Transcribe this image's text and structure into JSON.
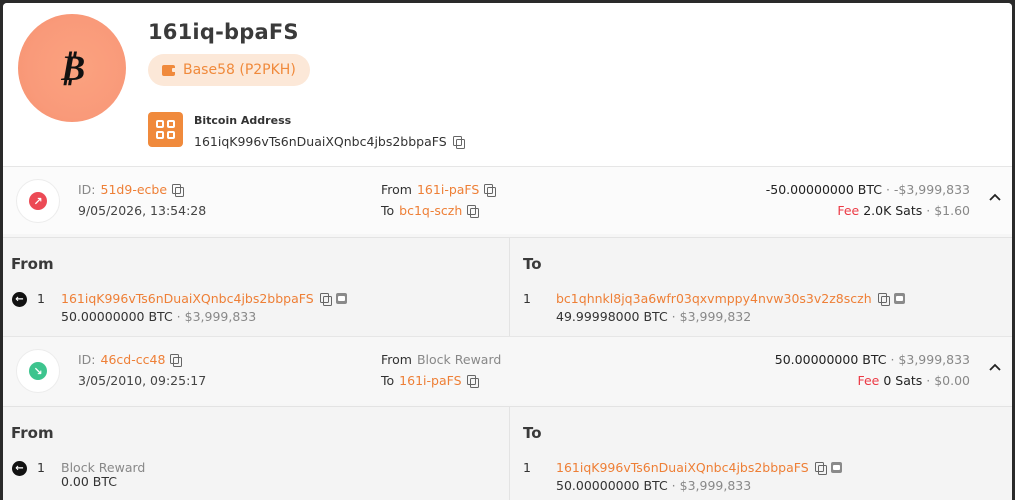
{
  "header": {
    "avatar_symbol": "₿",
    "title": "161iq-bpaFS",
    "badge_label": "Base58 (P2PKH)",
    "address_label": "Bitcoin Address",
    "address_value": "161iqK996vTs6nDuaiXQnbc4jbs2bbpaFS"
  },
  "transactions": [
    {
      "direction": "out",
      "id_prefix": "ID:",
      "id": "51d9-ecbe",
      "date": "9/05/2026, 13:54:28",
      "from_label": "From",
      "from": "161i-paFS",
      "to_label": "To",
      "to": "bc1q-sczh",
      "amount": "-50.00000000 BTC",
      "amount_usd": "· -$3,999,833",
      "fee_label": "Fee",
      "fee_sats": "2.0K Sats",
      "fee_usd": "· $1.60",
      "details": {
        "from_title": "From",
        "to_title": "To",
        "inputs": [
          {
            "index": "1",
            "address": "161iqK996vTs6nDuaiXQnbc4jbs2bbpaFS",
            "value": "50.00000000 BTC",
            "value_usd": "· $3,999,833"
          }
        ],
        "outputs": [
          {
            "index": "1",
            "address": "bc1qhnkl8jq3a6wfr03qxvmppy4nvw30s3v2z8sczh",
            "value": "49.99998000 BTC",
            "value_usd": "· $3,999,832"
          }
        ]
      }
    },
    {
      "direction": "in",
      "id_prefix": "ID:",
      "id": "46cd-cc48",
      "date": "3/05/2010, 09:25:17",
      "from_label": "From",
      "from": "Block Reward",
      "to_label": "To",
      "to": "161i-paFS",
      "amount": "50.00000000 BTC",
      "amount_usd": "· $3,999,833",
      "fee_label": "Fee",
      "fee_sats": "0 Sats",
      "fee_usd": "· $0.00",
      "details": {
        "from_title": "From",
        "to_title": "To",
        "inputs": [
          {
            "index": "1",
            "address": "Block Reward",
            "value": "0.00 BTC",
            "value_usd": ""
          }
        ],
        "outputs": [
          {
            "index": "1",
            "address": "161iqK996vTs6nDuaiXQnbc4jbs2bbpaFS",
            "value": "50.00000000 BTC",
            "value_usd": "· $3,999,833"
          }
        ]
      }
    }
  ],
  "colors": {
    "accent": "#ee7f36",
    "out": "#ec4a55",
    "in": "#3dc48e",
    "fee": "#ec3a45"
  }
}
